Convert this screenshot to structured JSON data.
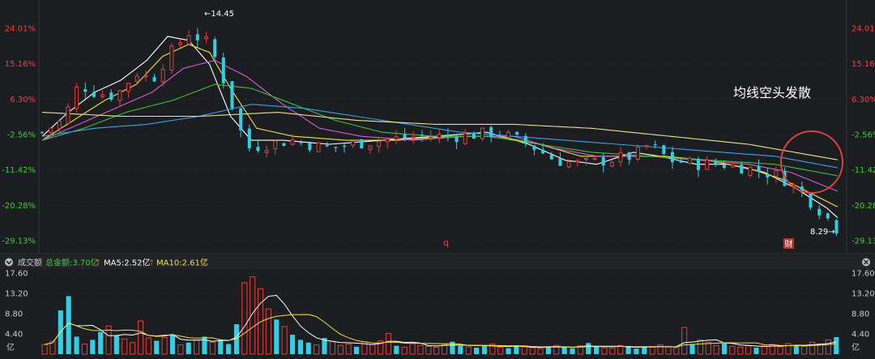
{
  "colors": {
    "background": "#1c1d21",
    "grid": "#3a3b40",
    "up": "#e0413b",
    "down": "#2fd0e6",
    "axis_pos": "#ff3a3a",
    "axis_neg": "#3ccf3c",
    "ma5": "#ffffff",
    "ma10": "#f0e33a",
    "ma20": "#d25fd2",
    "ma30": "#39c23a",
    "ma60": "#3aa0e8",
    "ma250": "#e8e28c",
    "circle": "#e0413b"
  },
  "price_axis_labels": [
    "24.01%",
    "15.16%",
    "6.30%",
    "-2.56%",
    "-11.42%",
    "-20.28%",
    "-29.13%"
  ],
  "max_label": "←14.45",
  "min_label": "8.29→",
  "annotation": "均线空头发散",
  "marker_q": "q",
  "marker_cai": "财",
  "volume_header": {
    "title": "成交额",
    "total": "总金额:3.70亿",
    "ma5": "MA5:2.52亿",
    "ma10": "MA10:2.61亿",
    "arrow": "↑"
  },
  "volume_axis_labels": [
    "17.60",
    "13.20",
    "8.80",
    "4.40",
    "亿"
  ],
  "chart_data": [
    {
      "type": "candlestick",
      "y_unit": "%",
      "ylim": [
        -29.13,
        24.01
      ],
      "y_ticks": [
        24.01,
        15.16,
        6.3,
        -2.56,
        -11.42,
        -20.28,
        -29.13
      ],
      "max_price": 14.45,
      "min_price": 8.29,
      "close_path": [
        [
          0,
          -2
        ],
        [
          8,
          1
        ],
        [
          14,
          10
        ],
        [
          20,
          8
        ],
        [
          28,
          7
        ],
        [
          36,
          13
        ],
        [
          42,
          11
        ],
        [
          48,
          17
        ],
        [
          56,
          23
        ],
        [
          64,
          20
        ],
        [
          70,
          10
        ],
        [
          78,
          -6
        ],
        [
          86,
          -5
        ],
        [
          96,
          -4
        ],
        [
          108,
          -6
        ],
        [
          118,
          -5
        ],
        [
          130,
          -4
        ],
        [
          144,
          -3
        ],
        [
          160,
          -3
        ],
        [
          174,
          -2
        ],
        [
          186,
          -5
        ],
        [
          196,
          -9
        ],
        [
          206,
          -10
        ],
        [
          216,
          -9
        ],
        [
          226,
          -8
        ],
        [
          232,
          -5
        ],
        [
          240,
          -9
        ],
        [
          250,
          -10
        ],
        [
          260,
          -10
        ],
        [
          270,
          -11
        ],
        [
          282,
          -13
        ],
        [
          290,
          -17
        ],
        [
          298,
          -22
        ],
        [
          305,
          -27
        ]
      ],
      "ma_series": [
        {
          "name": "MA5",
          "color_key": "ma5",
          "points": [
            [
              0,
              -3
            ],
            [
              10,
              3
            ],
            [
              20,
              8
            ],
            [
              30,
              11
            ],
            [
              40,
              16
            ],
            [
              48,
              22
            ],
            [
              56,
              21
            ],
            [
              64,
              15
            ],
            [
              72,
              2
            ],
            [
              80,
              -4
            ],
            [
              92,
              -4
            ],
            [
              110,
              -5
            ],
            [
              130,
              -4
            ],
            [
              150,
              -3
            ],
            [
              170,
              -2
            ],
            [
              186,
              -5
            ],
            [
              200,
              -9
            ],
            [
              212,
              -10
            ],
            [
              226,
              -7
            ],
            [
              236,
              -8
            ],
            [
              250,
              -10
            ],
            [
              262,
              -10
            ],
            [
              276,
              -12
            ],
            [
              288,
              -16
            ],
            [
              300,
              -21
            ],
            [
              305,
              -24
            ]
          ]
        },
        {
          "name": "MA10",
          "color_key": "ma10",
          "points": [
            [
              0,
              -4
            ],
            [
              12,
              1
            ],
            [
              24,
              6
            ],
            [
              36,
              10
            ],
            [
              46,
              17
            ],
            [
              56,
              20
            ],
            [
              64,
              18
            ],
            [
              72,
              9
            ],
            [
              82,
              -1
            ],
            [
              96,
              -3
            ],
            [
              116,
              -4
            ],
            [
              136,
              -4
            ],
            [
              156,
              -3
            ],
            [
              174,
              -3
            ],
            [
              190,
              -5
            ],
            [
              206,
              -8
            ],
            [
              222,
              -8
            ],
            [
              238,
              -8
            ],
            [
              254,
              -9
            ],
            [
              270,
              -11
            ],
            [
              284,
              -14
            ],
            [
              296,
              -18
            ],
            [
              305,
              -21
            ]
          ]
        },
        {
          "name": "MA20",
          "color_key": "ma20",
          "points": [
            [
              0,
              -4
            ],
            [
              14,
              0
            ],
            [
              28,
              4
            ],
            [
              42,
              8
            ],
            [
              54,
              14
            ],
            [
              66,
              16
            ],
            [
              78,
              12
            ],
            [
              92,
              5
            ],
            [
              106,
              -1
            ],
            [
              122,
              -3
            ],
            [
              142,
              -4
            ],
            [
              162,
              -3
            ],
            [
              180,
              -3
            ],
            [
              196,
              -6
            ],
            [
              212,
              -8
            ],
            [
              232,
              -8
            ],
            [
              252,
              -9
            ],
            [
              270,
              -10
            ],
            [
              286,
              -12
            ],
            [
              305,
              -17
            ]
          ]
        },
        {
          "name": "MA30",
          "color_key": "ma30",
          "points": [
            [
              0,
              -4
            ],
            [
              16,
              -1
            ],
            [
              32,
              3
            ],
            [
              50,
              6
            ],
            [
              66,
              10
            ],
            [
              80,
              9
            ],
            [
              96,
              5
            ],
            [
              112,
              1
            ],
            [
              130,
              -2
            ],
            [
              150,
              -3
            ],
            [
              170,
              -3
            ],
            [
              190,
              -5
            ],
            [
              210,
              -7
            ],
            [
              232,
              -8
            ],
            [
              256,
              -9
            ],
            [
              280,
              -10
            ],
            [
              305,
              -13
            ]
          ]
        },
        {
          "name": "MA60",
          "color_key": "ma60",
          "points": [
            [
              0,
              -3
            ],
            [
              20,
              -1
            ],
            [
              40,
              0
            ],
            [
              60,
              2
            ],
            [
              80,
              5
            ],
            [
              100,
              4
            ],
            [
              120,
              2
            ],
            [
              140,
              0
            ],
            [
              160,
              -2
            ],
            [
              180,
              -3
            ],
            [
              200,
              -4
            ],
            [
              220,
              -5
            ],
            [
              240,
              -6
            ],
            [
              260,
              -7
            ],
            [
              280,
              -8
            ],
            [
              305,
              -11
            ]
          ]
        },
        {
          "name": "MA250",
          "color_key": "ma250",
          "points": [
            [
              0,
              3
            ],
            [
              30,
              2
            ],
            [
              60,
              2
            ],
            [
              90,
              3
            ],
            [
              120,
              1
            ],
            [
              150,
              0
            ],
            [
              180,
              0
            ],
            [
              210,
              -1
            ],
            [
              240,
              -3
            ],
            [
              270,
              -5
            ],
            [
              305,
              -9
            ]
          ]
        }
      ]
    },
    {
      "type": "bar",
      "y_unit": "亿",
      "ylim": [
        0,
        17.6
      ],
      "y_ticks": [
        4.4,
        8.8,
        13.2,
        17.6
      ],
      "values_pattern": [
        2.1,
        2.8,
        9.5,
        12.6,
        3.8,
        2.2,
        3.1,
        4.8,
        6.1,
        4.0,
        3.3,
        2.5,
        7.2,
        3.5,
        2.9,
        3.6,
        4.2,
        2.0,
        2.5,
        3.0,
        3.8,
        2.6,
        3.1,
        2.2,
        6.5,
        15.5,
        16.8,
        14.2,
        9.8,
        7.5,
        6.0,
        4.2,
        3.1,
        2.5,
        2.0,
        3.5,
        2.8,
        1.9,
        2.2,
        1.6,
        2.7,
        2.1,
        2.9,
        4.5,
        1.8,
        1.5,
        2.3,
        1.9,
        1.7,
        1.5,
        2.1,
        2.7,
        1.8,
        1.6,
        1.4,
        1.9,
        2.2,
        1.5,
        1.3,
        1.8,
        1.6,
        1.4,
        1.2,
        1.7,
        1.9,
        1.5,
        1.3,
        1.8,
        2.4,
        1.6,
        1.4,
        1.3,
        1.9,
        1.7,
        1.2,
        1.6,
        1.5,
        2.0,
        1.7,
        1.4,
        5.8,
        2.2,
        3.1,
        2.6,
        1.9,
        2.3,
        1.7,
        1.5,
        1.9,
        1.4,
        1.8,
        2.1,
        1.6,
        2.3,
        1.9,
        1.7,
        2.6,
        2.2,
        3.1,
        3.7
      ]
    }
  ]
}
